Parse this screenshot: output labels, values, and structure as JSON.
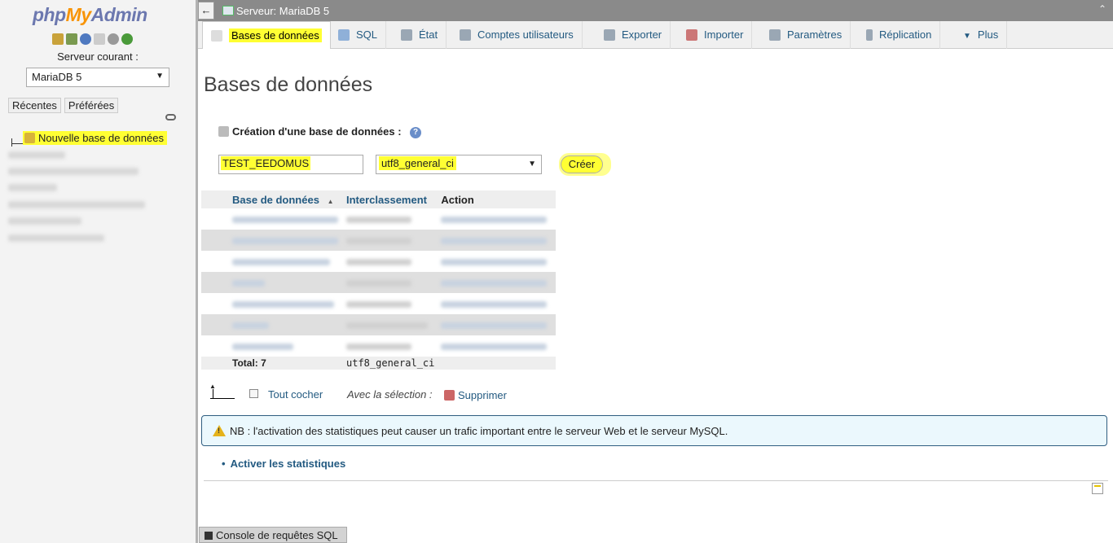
{
  "left": {
    "logo": {
      "part1": "php",
      "part2": "My",
      "part3": "Admin"
    },
    "server_label": "Serveur courant :",
    "server_select": "MariaDB 5",
    "recent": "Récentes",
    "favorites": "Préférées",
    "new_db": "Nouvelle base de données"
  },
  "topbar": {
    "back": "←",
    "server": "Serveur: MariaDB 5",
    "collapse": "⌃"
  },
  "tabs": [
    {
      "label": "Bases de données",
      "active": true
    },
    {
      "label": "SQL"
    },
    {
      "label": "État"
    },
    {
      "label": "Comptes utilisateurs"
    },
    {
      "label": "Exporter"
    },
    {
      "label": "Importer"
    },
    {
      "label": "Paramètres"
    },
    {
      "label": "Réplication"
    },
    {
      "label": "Plus"
    }
  ],
  "main": {
    "title": "Bases de données",
    "create_label": "Création d'une base de données :",
    "help": "?",
    "db_name_value": "TEST_EEDOMUS",
    "collation_value": "utf8_general_ci",
    "create_button": "Créer",
    "table": {
      "headers": [
        "Base de données",
        "Interclassement",
        "Action"
      ],
      "sort_arrow": "▲",
      "total_label": "Total: 7",
      "total_collation": "utf8_general_ci"
    },
    "check_all": "Tout cocher",
    "with_selection": "Avec la sélection :",
    "delete": "Supprimer",
    "notice": "NB : l'activation des statistiques peut causer un trafic important entre le serveur Web et le serveur MySQL.",
    "activate_stats": "Activer les statistiques"
  },
  "console": "Console de requêtes SQL"
}
